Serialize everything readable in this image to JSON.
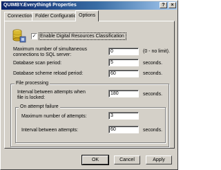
{
  "window": {
    "title": "QUIMBY.Everything6 Properties"
  },
  "title_buttons": {
    "help": "?",
    "close": "×"
  },
  "tabs": [
    {
      "label": "Connection"
    },
    {
      "label": "Folder Configuration"
    },
    {
      "label": "Options"
    }
  ],
  "options": {
    "enable_checkbox": {
      "label": "Enable Digital Resources Classification",
      "checked": "✓"
    },
    "max_connections": {
      "label_line1": "Maximum number of simultaneous",
      "label_line2": "connections to SQL server:",
      "value": "0",
      "unit": "(0 - no limit)."
    },
    "scan_period": {
      "label": "Database scan period:",
      "value": "5",
      "unit": "seconds."
    },
    "reload_period": {
      "label": "Database scheme reload period:",
      "value": "60",
      "unit": "seconds."
    },
    "file_processing": {
      "legend": "File processing",
      "interval_locked": {
        "label_line1": "Interval between attempts when",
        "label_line2": "file is locked:",
        "value": "180",
        "unit": "seconds."
      },
      "on_failure": {
        "legend": "On attempt failure",
        "max_attempts": {
          "label": "Maximum number of attempts:",
          "value": "3"
        },
        "interval": {
          "label": "Interval between attempts:",
          "value": "60",
          "unit": "seconds."
        }
      }
    }
  },
  "buttons": {
    "ok": "OK",
    "cancel": "Cancel",
    "apply": "Apply"
  }
}
